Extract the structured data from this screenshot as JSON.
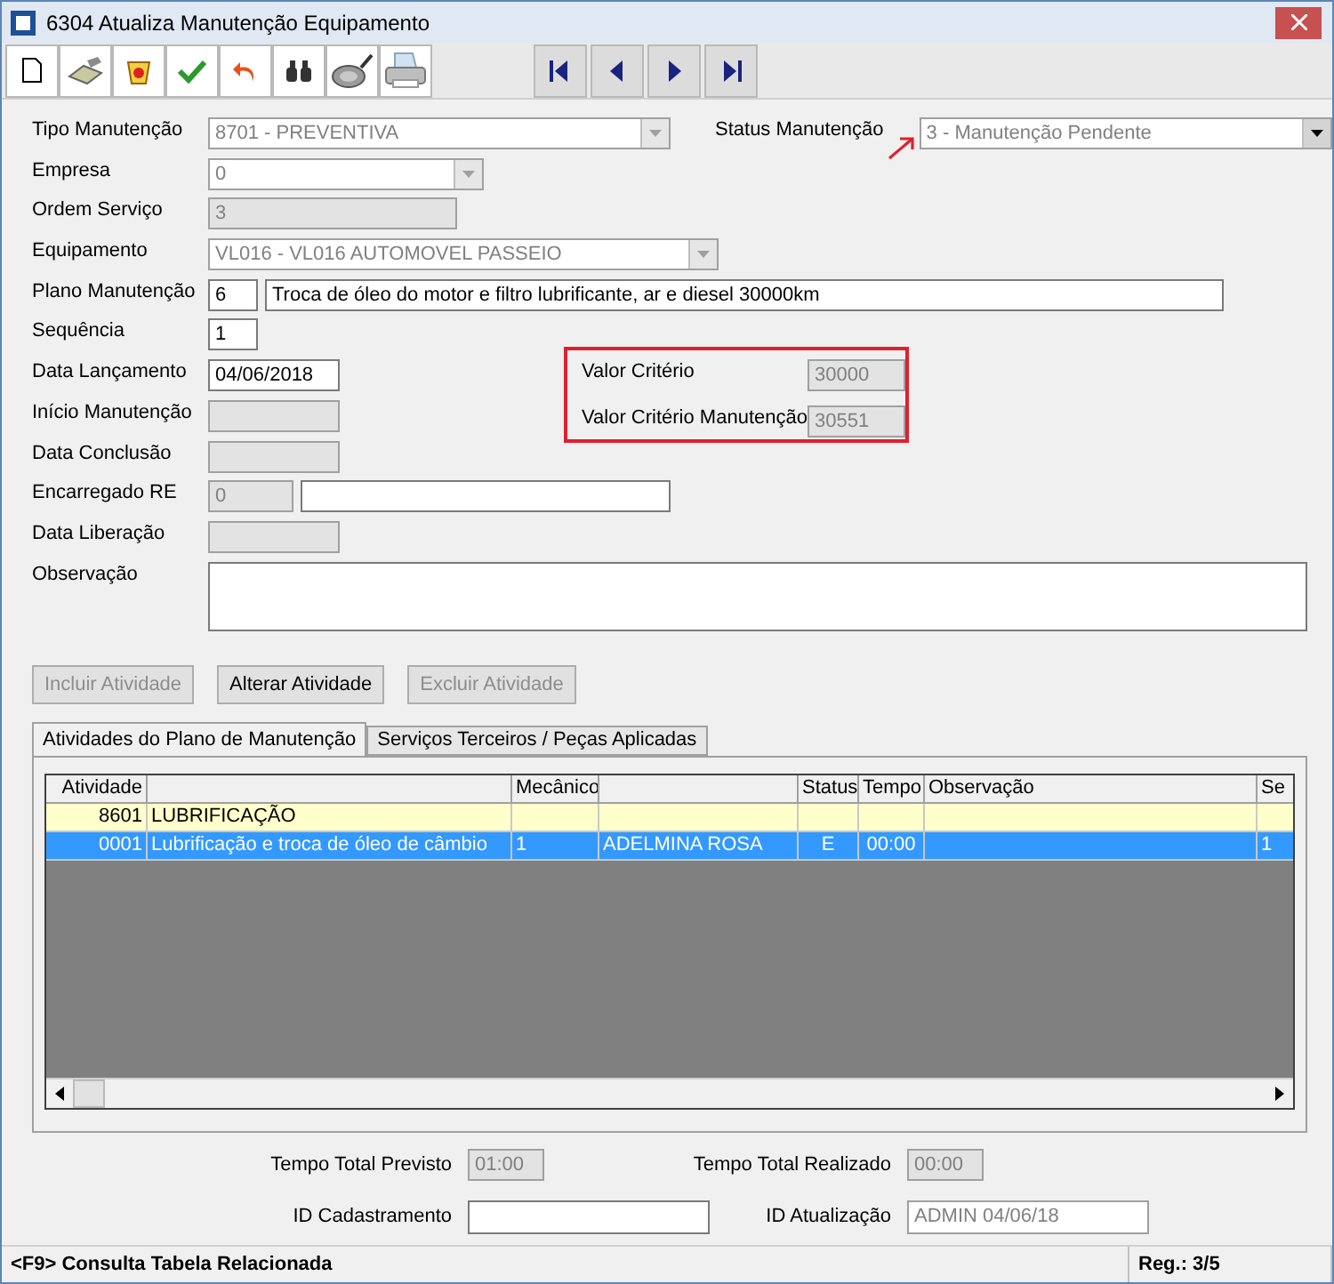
{
  "window": {
    "title": "6304 Atualiza Manutenção Equipamento"
  },
  "form": {
    "fields": [
      {
        "label": "Tipo Manutenção",
        "controls": [
          {
            "kind": "combo",
            "value": "8701 - PREVENTIVA",
            "disabled": true
          }
        ]
      },
      {
        "label": "Empresa",
        "controls": [
          {
            "kind": "combo",
            "value": "0",
            "disabled": true
          }
        ]
      },
      {
        "label": "Ordem Serviço",
        "controls": [
          {
            "kind": "text",
            "value": "3",
            "disabled": true
          }
        ]
      },
      {
        "label": "Equipamento",
        "controls": [
          {
            "kind": "combo",
            "value": "VL016 - VL016 AUTOMOVEL PASSEIO",
            "disabled": true
          }
        ]
      },
      {
        "label": "Plano Manutenção",
        "controls": [
          {
            "kind": "text",
            "value": "6",
            "disabled": false
          },
          {
            "kind": "text",
            "value": "Troca de óleo do motor e filtro lubrificante, ar e diesel 30000km",
            "disabled": false
          }
        ]
      },
      {
        "label": "Sequência",
        "controls": [
          {
            "kind": "text",
            "value": "1",
            "disabled": false
          }
        ]
      },
      {
        "label": "Data Lançamento",
        "controls": [
          {
            "kind": "text",
            "value": "04/06/2018",
            "disabled": false
          }
        ]
      },
      {
        "label": "Início Manutenção",
        "controls": [
          {
            "kind": "text",
            "disabled": true
          }
        ]
      },
      {
        "label": "Data Conclusão",
        "controls": [
          {
            "kind": "text",
            "disabled": true
          }
        ]
      },
      {
        "label": "Encarregado  RE",
        "controls": [
          {
            "kind": "text",
            "value": "0",
            "disabled": true
          },
          {
            "kind": "text",
            "disabled": false
          }
        ]
      },
      {
        "label": "Data Liberação",
        "controls": [
          {
            "kind": "text",
            "disabled": true
          }
        ]
      },
      {
        "label": "Observação",
        "controls": [
          {
            "kind": "memo",
            "disabled": false
          }
        ]
      }
    ],
    "status_field": {
      "label": "Status Manutenção",
      "value": "3 - Manutenção Pendente",
      "disabled": false
    },
    "criteria": [
      {
        "label": "Valor Critério",
        "value": "30000"
      },
      {
        "label": "Valor Critério Manutenção",
        "value": "30551"
      }
    ]
  },
  "buttons": [
    {
      "label": "Incluir Atividade",
      "disabled": true
    },
    {
      "label": "Alterar Atividade",
      "disabled": false
    },
    {
      "label": "Excluir Atividade",
      "disabled": true
    }
  ],
  "tabs": [
    {
      "label": "Atividades do Plano de Manutenção",
      "selected": true
    },
    {
      "label": "Serviços Terceiros / Peças Aplicadas",
      "selected": false
    }
  ],
  "table": {
    "columns": [
      "Atividade",
      "",
      "Mecânico",
      "",
      "Status",
      "Tempo",
      "Observação",
      "Se"
    ],
    "rows": [
      {
        "kind": "group",
        "selected": false,
        "cells": [
          "8601",
          "LUBRIFICAÇÃO",
          "",
          "",
          "",
          "",
          "",
          ""
        ]
      },
      {
        "kind": "item",
        "selected": true,
        "cells": [
          "0001",
          "Lubrificação e troca de óleo de câmbio",
          "1",
          "ADELMINA ROSA",
          "E",
          "00:00",
          "",
          "1"
        ]
      }
    ]
  },
  "totals": [
    {
      "label": "Tempo Total Previsto",
      "value": "01:00"
    },
    {
      "label": "Tempo Total Realizado",
      "value": "00:00"
    }
  ],
  "ids": [
    {
      "label": "ID Cadastramento",
      "disabled": false
    },
    {
      "label": "ID Atualização",
      "value": "ADMIN 04/06/18",
      "disabled": true
    }
  ],
  "status_bar": {
    "hint": "<F9> Consulta Tabela Relacionada",
    "record": "Reg.: 3/5"
  }
}
